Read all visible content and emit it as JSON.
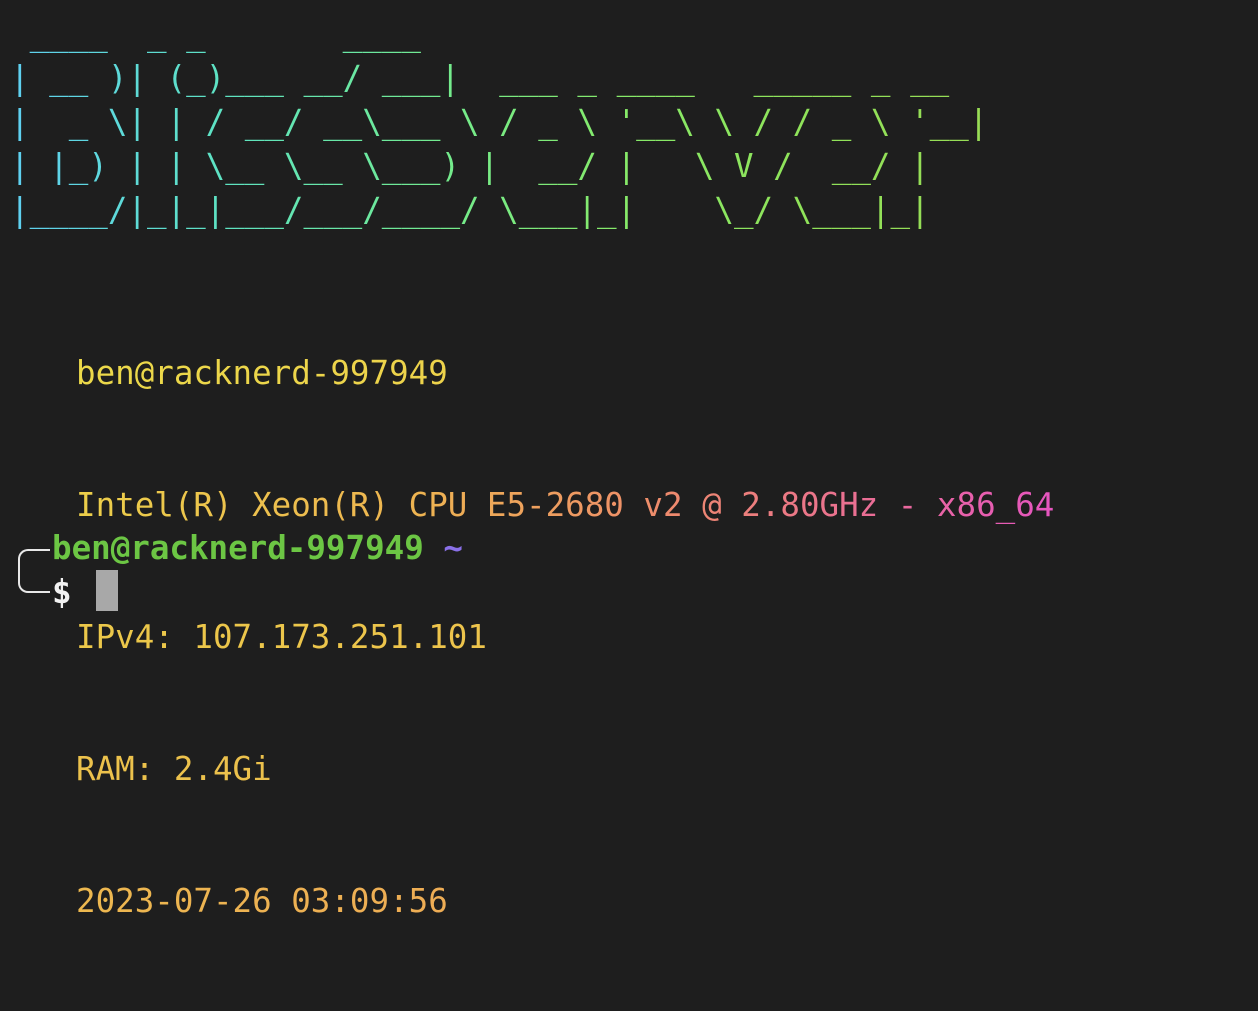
{
  "banner": {
    "text": " ____  _ _       ____\n| __ )| (_)___ __/ ___|  ___ _ ____   _____ _ __\n|  _ \\| | / __/ __\\___ \\ / _ \\ '__\\ \\ / / _ \\ '__|\n| |_) | | \\__ \\__ \\___) |  __/ |   \\ V /  __/ |\n|____/|_|_|___/___/____/ \\___|_|    \\_/ \\___|_|"
  },
  "system_info": {
    "hostname": "ben@racknerd-997949",
    "cpu": "Intel(R) Xeon(R) CPU E5-2680 v2 @ 2.80GHz - x86_64",
    "ipv4": "IPv4: 107.173.251.101",
    "ram": "RAM: 2.4Gi",
    "datetime": "2023-07-26 03:09:56"
  },
  "prompt": {
    "user_host": "ben@racknerd-997949",
    "cwd": "~",
    "symbol": "$"
  },
  "colors": {
    "background": "#1e1e1e",
    "prompt_user": "#6cc644",
    "prompt_cwd": "#8a70e8",
    "cursor": "#a8a8a8"
  }
}
